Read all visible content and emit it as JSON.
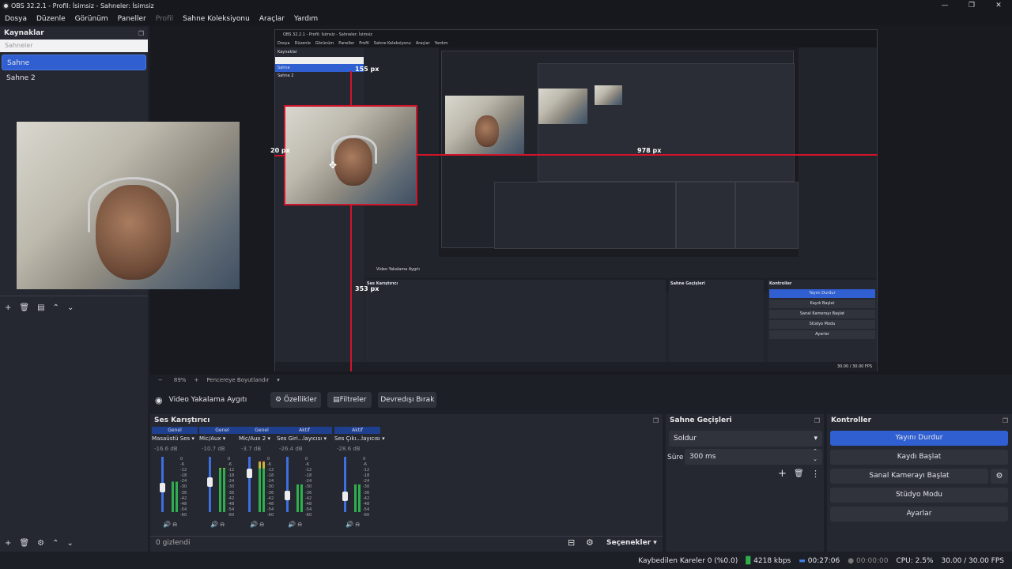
{
  "window": {
    "title": "OBS 32.2.1 - Profil: İsimsiz - Sahneler: İsimsiz"
  },
  "menu": {
    "items": [
      "Dosya",
      "Düzenle",
      "Görünüm",
      "Paneller",
      "Profil",
      "Sahne Koleksiyonu",
      "Araçlar",
      "Yardım"
    ]
  },
  "scenes_dock": {
    "title": "Kaynaklar",
    "search_placeholder": "Sahneler",
    "items": [
      "Sahne",
      "Sahne 2"
    ]
  },
  "preview": {
    "inner_title": "OBS 32.2.1 - Profil: İsimsiz - Sahneler: İsimsiz",
    "measure_labels": {
      "top": "155 px",
      "left": "20 px",
      "right": "978 px",
      "bottom": "353 px"
    },
    "zoom": "89%",
    "zoom_mode": "Pencereye Boyutlandır"
  },
  "context_bar": {
    "source": "Video Yakalama Aygıtı",
    "properties": "Özellikler",
    "filters": "Filtreler",
    "deactivate": "Devredışı Bırak"
  },
  "mixer": {
    "title": "Ses Karıştırıcı",
    "channels": [
      {
        "header": "Genel",
        "name": "Masaüstü Ses",
        "db": "-16.6 dB",
        "fader": 0.45,
        "level": 0.55
      },
      {
        "header": "Genel",
        "name": "Mic/Aux",
        "db": "-10.7 dB",
        "fader": 0.55,
        "level": 0.8
      },
      {
        "header": "Genel",
        "name": "Mic/Aux 2",
        "db": "-3.7 dB",
        "fader": 0.7,
        "level": 0.92
      },
      {
        "header": "Aktif",
        "name": "Ses Giri...layıcısı",
        "db": "-26.4 dB",
        "fader": 0.3,
        "level": 0.5
      },
      {
        "header": "Aktif",
        "name": "Ses Çıkı...layıcısı",
        "db": "-28.6 dB",
        "fader": 0.28,
        "level": 0.5
      }
    ],
    "scale": [
      "0",
      "-6",
      "-12",
      "-18",
      "-24",
      "-30",
      "-36",
      "-42",
      "-48",
      "-54",
      "-60"
    ],
    "hidden": "0 gizlendi",
    "options": "Seçenekler"
  },
  "transitions": {
    "title": "Sahne Geçişleri",
    "selected": "Soldur",
    "duration_label": "Süre",
    "duration_value": "300 ms"
  },
  "controls": {
    "title": "Kontroller",
    "stream": "Yayını Durdur",
    "record": "Kaydı Başlat",
    "virtualcam": "Sanal Kamerayı Başlat",
    "studio": "Stüdyo Modu",
    "settings": "Ayarlar"
  },
  "status": {
    "dropped": "Kaybedilen Kareler 0 (%0.0)",
    "bitrate": "4218 kbps",
    "stream_time": "00:27:06",
    "rec_time": "00:00:00",
    "cpu": "CPU: 2.5%",
    "fps": "30.00 / 30.00 FPS"
  }
}
